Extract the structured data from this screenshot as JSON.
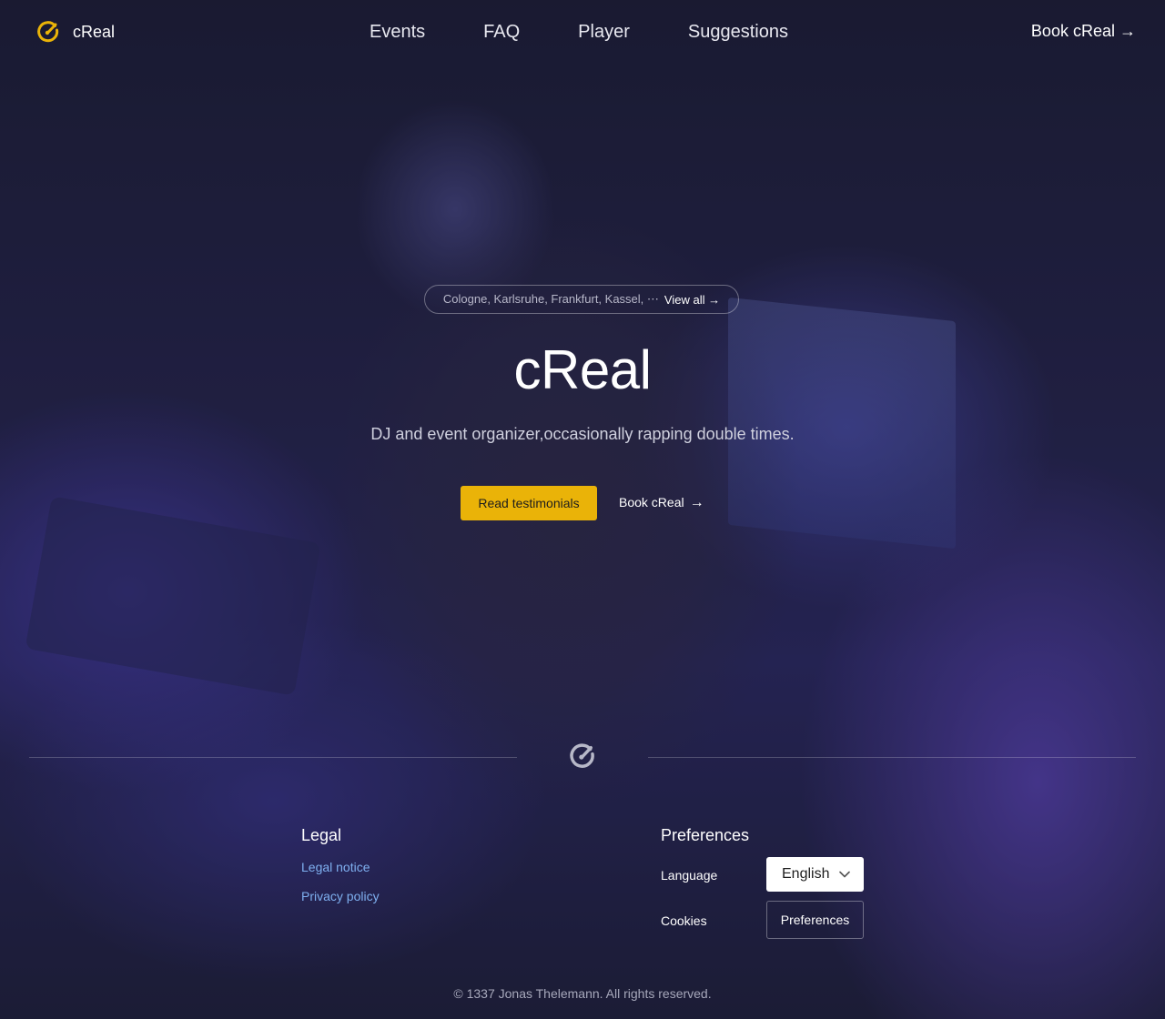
{
  "brand": {
    "name": "cReal",
    "accent_color": "#eab308",
    "logo_icon": "logo-icon"
  },
  "nav": {
    "items": [
      {
        "label": "Events"
      },
      {
        "label": "FAQ"
      },
      {
        "label": "Player"
      },
      {
        "label": "Suggestions"
      }
    ],
    "cta_label": "Book cReal",
    "cta_arrow": "→"
  },
  "hero": {
    "locations": "Cologne, Karlsruhe, Frankfurt, Kassel, ⋯",
    "view_all_label": "View all →",
    "title": "cReal",
    "subtitle": "DJ and event organizer,occasionally rapping double times.",
    "primary_button": "Read testimonials",
    "secondary_button": "Book cReal",
    "secondary_arrow": "→"
  },
  "footer": {
    "legal": {
      "heading": "Legal",
      "links": [
        {
          "label": "Legal notice"
        },
        {
          "label": "Privacy policy"
        }
      ]
    },
    "preferences": {
      "heading": "Preferences",
      "language_label": "Language",
      "language_value": "English",
      "cookies_label": "Cookies",
      "cookies_button": "Preferences"
    },
    "copyright": "© 1337 Jonas Thelemann. All rights reserved.",
    "link_color": "#7fb0f0"
  }
}
